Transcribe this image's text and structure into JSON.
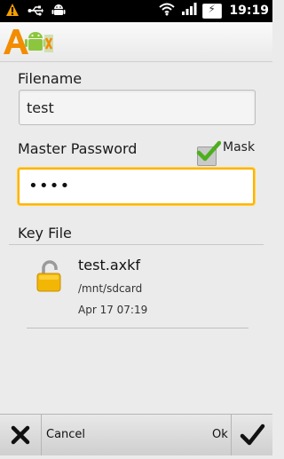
{
  "status_bar": {
    "time": "19:19",
    "left_icons": [
      "warning-icon",
      "usb-icon",
      "android-debug-icon"
    ],
    "right_icons": [
      "wifi-icon",
      "signal-icon",
      "battery-charging-icon"
    ]
  },
  "app": {
    "logo_text": "A"
  },
  "form": {
    "filename_label": "Filename",
    "filename_value": "test",
    "password_label": "Master Password",
    "password_masked": "••••",
    "mask_label": "Mask",
    "mask_checked": true,
    "keyfile_label": "Key File"
  },
  "file": {
    "name": "test.axkf",
    "path": "/mnt/sdcard",
    "date": "Apr 17 07:19",
    "icon": "padlock-open-icon"
  },
  "bottom_bar": {
    "cancel_label": "Cancel",
    "ok_label": "Ok"
  },
  "colors": {
    "focus_border": "#ffb300",
    "check_green": "#4caf1e",
    "lock_gold": "#f2b705"
  }
}
